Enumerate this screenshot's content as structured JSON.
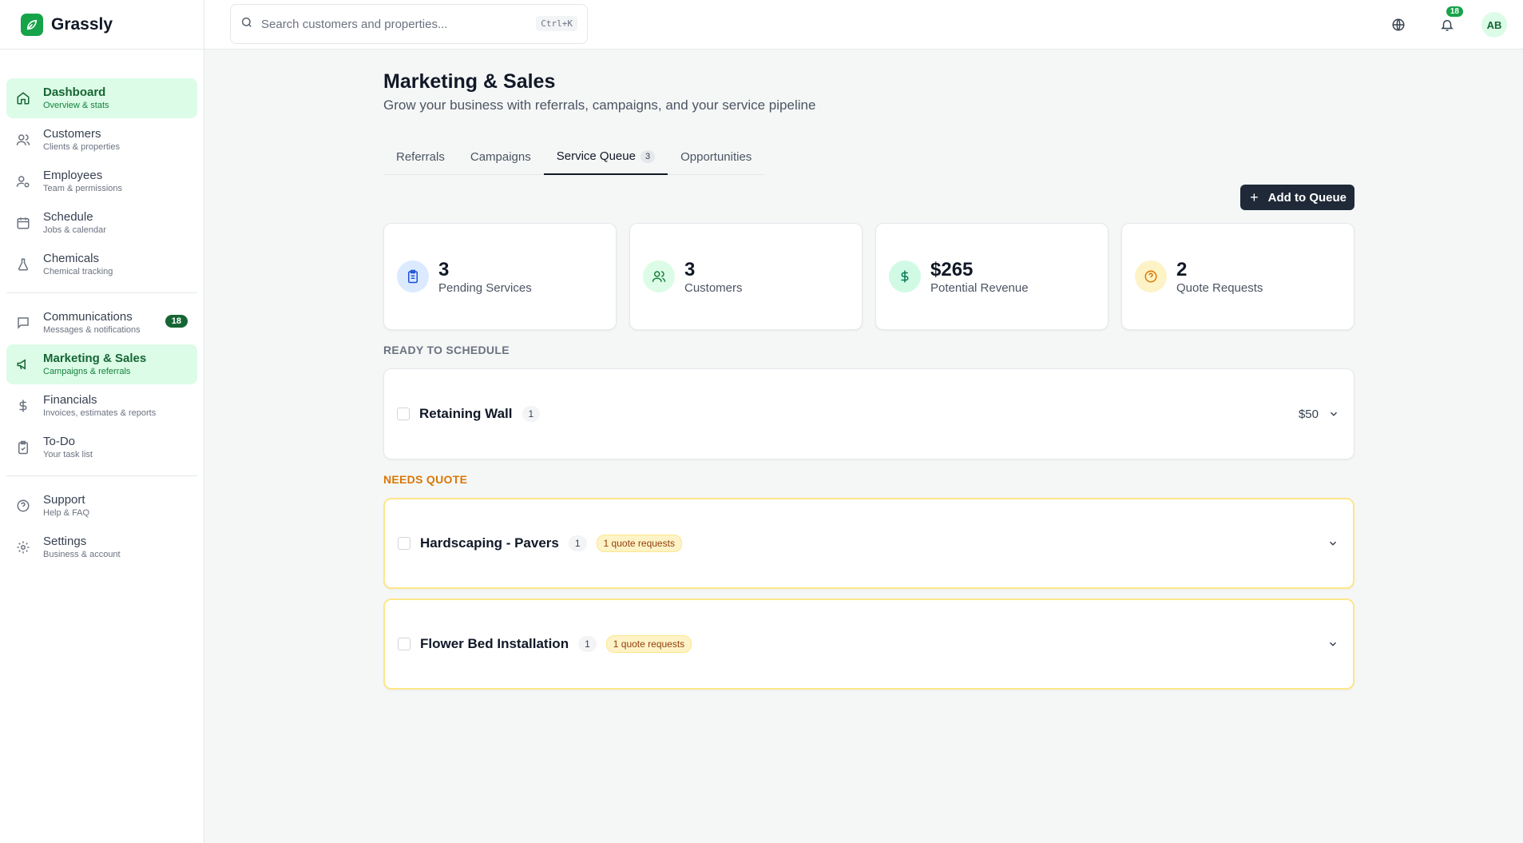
{
  "app": {
    "name": "Grassly"
  },
  "search": {
    "placeholder": "Search customers and properties...",
    "shortcut": "Ctrl+K"
  },
  "header": {
    "notification_count": "18",
    "avatar_initials": "AB"
  },
  "sidebar": {
    "items": [
      {
        "label": "Dashboard",
        "sub": "Overview & stats"
      },
      {
        "label": "Customers",
        "sub": "Clients & properties"
      },
      {
        "label": "Employees",
        "sub": "Team & permissions"
      },
      {
        "label": "Schedule",
        "sub": "Jobs & calendar"
      },
      {
        "label": "Chemicals",
        "sub": "Chemical tracking"
      },
      {
        "label": "Communications",
        "sub": "Messages & notifications",
        "badge": "18"
      },
      {
        "label": "Marketing & Sales",
        "sub": "Campaigns & referrals"
      },
      {
        "label": "Financials",
        "sub": "Invoices, estimates & reports"
      },
      {
        "label": "To-Do",
        "sub": "Your task list"
      },
      {
        "label": "Support",
        "sub": "Help & FAQ"
      },
      {
        "label": "Settings",
        "sub": "Business & account"
      }
    ]
  },
  "page": {
    "title": "Marketing & Sales",
    "subtitle": "Grow your business with referrals, campaigns, and your service pipeline"
  },
  "tabs": [
    {
      "label": "Referrals"
    },
    {
      "label": "Campaigns"
    },
    {
      "label": "Service Queue",
      "count": "3"
    },
    {
      "label": "Opportunities"
    }
  ],
  "actions": {
    "add_label": "Add to Queue"
  },
  "stats": [
    {
      "value": "3",
      "label": "Pending Services"
    },
    {
      "value": "3",
      "label": "Customers"
    },
    {
      "value": "$265",
      "label": "Potential Revenue"
    },
    {
      "value": "2",
      "label": "Quote Requests"
    }
  ],
  "sections": {
    "ready": {
      "heading": "READY TO SCHEDULE",
      "items": [
        {
          "title": "Retaining Wall",
          "count": "1",
          "price": "$50"
        }
      ]
    },
    "needs_quote": {
      "heading": "NEEDS QUOTE",
      "items": [
        {
          "title": "Hardscaping - Pavers",
          "count": "1",
          "badge": "1 quote requests"
        },
        {
          "title": "Flower Bed Installation",
          "count": "1",
          "badge": "1 quote requests"
        }
      ]
    }
  },
  "colors": {
    "brand": "#16a34a",
    "active_bg": "#dcfce7",
    "warning": "#d97706"
  }
}
